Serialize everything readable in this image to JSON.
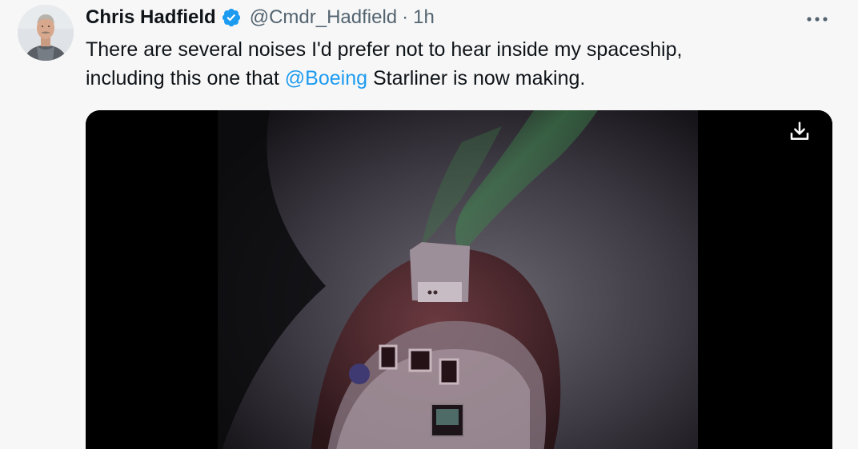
{
  "tweet": {
    "author_name": "Chris Hadfield",
    "handle": "@Cmdr_Hadfield",
    "separator": "·",
    "time": "1h",
    "text_part1": "There are several noises I'd prefer not to hear inside my spaceship,",
    "text_part2_prefix": "including this one that ",
    "mention": "@Boeing",
    "text_part2_suffix": " Starliner is now making."
  },
  "icons": {
    "verified": "verified-badge-icon",
    "more": "more-options-icon",
    "download": "download-icon"
  },
  "colors": {
    "link": "#1d9bf0",
    "verified": "#1d9bf0",
    "secondary_text": "#536471",
    "text": "#0f1419"
  }
}
